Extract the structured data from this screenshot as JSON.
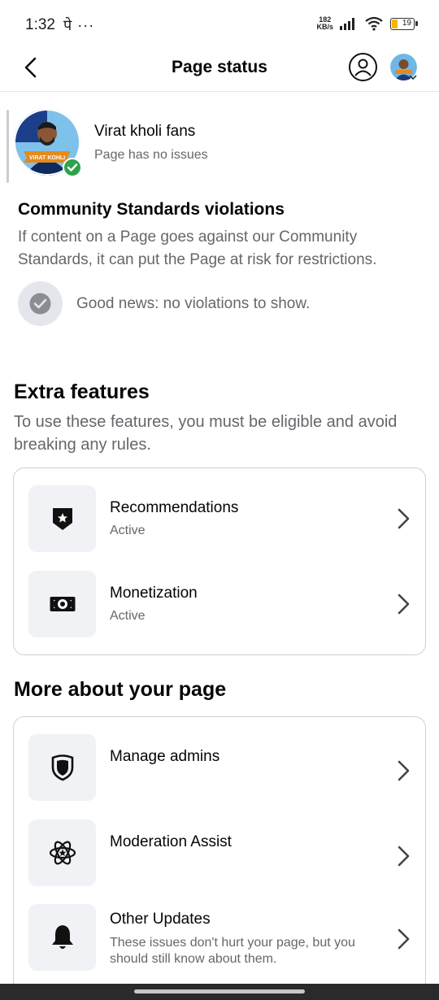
{
  "status_bar": {
    "time": "1:32",
    "extra": "पे ···",
    "net_speed_value": "182",
    "net_speed_unit": "KB/s",
    "battery": "19"
  },
  "header": {
    "title": "Page status"
  },
  "page": {
    "name": "Virat kholi fans",
    "status": "Page has no issues"
  },
  "community_standards": {
    "title": "Community Standards violations",
    "description": "If content on a Page goes against our Community Standards, it can put the Page at risk for restrictions.",
    "good_news": "Good news: no violations to show."
  },
  "extra_features": {
    "title": "Extra features",
    "description": "To use these features, you must be eligible and avoid breaking any rules.",
    "items": [
      {
        "label": "Recommendations",
        "status": "Active",
        "icon": "shield-star-icon"
      },
      {
        "label": "Monetization",
        "status": "Active",
        "icon": "money-icon"
      }
    ]
  },
  "more_about": {
    "title": "More about your page",
    "items": [
      {
        "label": "Manage admins",
        "icon": "shield-icon"
      },
      {
        "label": "Moderation Assist",
        "icon": "atom-icon"
      },
      {
        "label": "Other Updates",
        "description": "These issues don't hurt your page, but you should still know about them.",
        "icon": "bell-icon"
      }
    ]
  },
  "colors": {
    "primary_text": "#050505",
    "secondary_text": "#65676b",
    "success_green": "#31a24c",
    "icon_bg": "#f0f2f5"
  }
}
